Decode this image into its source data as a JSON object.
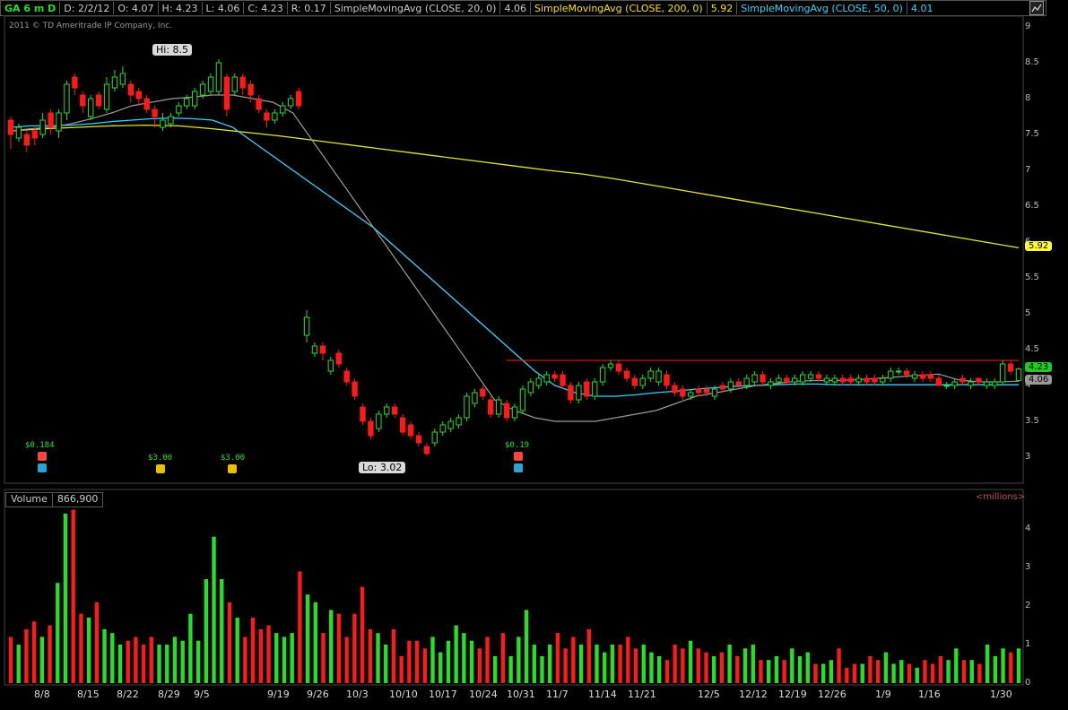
{
  "header": {
    "symbol": "GA 6 m D",
    "date": "D: 2/2/12",
    "open": "O: 4.07",
    "high": "H: 4.23",
    "low": "L: 4.06",
    "close": "C: 4.23",
    "range": "R: 0.17",
    "sma20_label": "SimpleMovingAvg (CLOSE, 20, 0)",
    "sma20_value": "4.06",
    "sma200_label": "SimpleMovingAvg (CLOSE, 200, 0)",
    "sma200_value": "5.92",
    "sma50_label": "SimpleMovingAvg (CLOSE, 50, 0)",
    "sma50_value": "4.01"
  },
  "copyright": "2011 © TD Ameritrade IP Company, Inc.",
  "volume_header": {
    "label": "Volume",
    "value": "866,900",
    "units": "<millions>"
  },
  "colors": {
    "up": "#25e025",
    "down": "#ff1a1a",
    "sma20": "#9a9a9a",
    "sma50": "#33d6ff",
    "sma200": "#e6e633",
    "resistance": "#ff2020"
  },
  "chart_data": [
    {
      "type": "candlestick",
      "title": "GA 6 m D",
      "ylim": [
        2.75,
        9.1
      ],
      "yticks": [
        "9",
        "8.5",
        "8",
        "7.5",
        "7",
        "6.5",
        "6",
        "5.5",
        "5",
        "4.5",
        "4",
        "3.5",
        "3"
      ],
      "xticks": [
        "8/8",
        "8/15",
        "8/22",
        "8/29",
        "9/5",
        "9/19",
        "9/26",
        "10/3",
        "10/10",
        "10/17",
        "10/24",
        "10/31",
        "11/7",
        "11/14",
        "11/21",
        "12/5",
        "12/12",
        "12/19",
        "12/26",
        "1/9",
        "1/16",
        "1/30"
      ],
      "close": [
        7.5,
        7.6,
        7.35,
        7.45,
        7.7,
        7.6,
        7.8,
        8.2,
        8.15,
        7.9,
        8.0,
        7.9,
        8.2,
        8.3,
        8.35,
        8.05,
        8.0,
        7.85,
        7.75,
        7.7,
        7.75,
        7.9,
        8.0,
        8.1,
        8.2,
        8.3,
        8.5,
        7.85,
        8.3,
        8.15,
        8.05,
        7.85,
        7.7,
        7.8,
        7.9,
        8.0,
        7.9,
        4.95,
        4.55,
        4.45,
        4.35,
        4.3,
        4.05,
        3.85,
        3.5,
        3.3,
        3.6,
        3.7,
        3.6,
        3.35,
        3.3,
        3.2,
        3.05,
        3.35,
        3.45,
        3.5,
        3.55,
        3.85,
        3.9,
        3.85,
        3.6,
        3.8,
        3.55,
        3.7,
        3.95,
        4.05,
        4.1,
        4.15,
        4.1,
        4.0,
        3.8,
        4.0,
        3.85,
        4.05,
        4.25,
        4.3,
        4.2,
        4.1,
        4.0,
        4.1,
        4.2,
        4.2,
        4.0,
        3.9,
        3.85,
        3.9,
        3.9,
        3.9,
        3.95,
        3.95,
        4.05,
        4.0,
        4.1,
        4.15,
        4.05,
        4.05,
        4.1,
        4.05,
        4.1,
        4.15,
        4.15,
        4.1,
        4.1,
        4.1,
        4.05,
        4.05,
        4.1,
        4.05,
        4.05,
        4.1,
        4.2,
        4.2,
        4.15,
        4.15,
        4.1,
        4.1,
        4.0,
        4.0,
        4.05,
        4.05,
        4.05,
        4.05,
        4.05,
        4.05,
        4.3,
        4.2,
        4.23
      ],
      "open": [
        7.7,
        7.45,
        7.5,
        7.55,
        7.5,
        7.8,
        7.55,
        7.8,
        8.3,
        8.05,
        7.75,
        8.05,
        7.85,
        8.15,
        8.2,
        8.2,
        8.1,
        8.0,
        7.85,
        7.6,
        7.65,
        7.8,
        7.9,
        7.9,
        8.05,
        8.1,
        8.1,
        8.3,
        8.1,
        8.3,
        8.2,
        8.0,
        7.8,
        7.7,
        7.8,
        7.9,
        8.1,
        4.7,
        4.45,
        4.55,
        4.2,
        4.45,
        4.2,
        4.05,
        3.7,
        3.5,
        3.4,
        3.6,
        3.7,
        3.55,
        3.45,
        3.3,
        3.15,
        3.2,
        3.35,
        3.4,
        3.45,
        3.55,
        3.75,
        3.95,
        3.8,
        3.6,
        3.75,
        3.55,
        3.65,
        3.9,
        4.0,
        4.05,
        4.15,
        4.15,
        4.0,
        3.8,
        4.05,
        3.85,
        4.05,
        4.25,
        4.3,
        4.2,
        4.1,
        4.0,
        4.1,
        4.05,
        4.15,
        4.0,
        3.95,
        3.85,
        3.95,
        3.95,
        3.85,
        4.0,
        3.95,
        4.05,
        4.0,
        4.05,
        4.15,
        4.0,
        4.05,
        4.1,
        4.05,
        4.05,
        4.1,
        4.15,
        4.05,
        4.05,
        4.1,
        4.1,
        4.05,
        4.1,
        4.1,
        4.05,
        4.1,
        4.2,
        4.2,
        4.1,
        4.15,
        4.15,
        4.1,
        4.0,
        4.0,
        4.1,
        4.0,
        4.1,
        4.0,
        4.0,
        4.05,
        4.3,
        4.07
      ],
      "high": [
        7.75,
        7.65,
        7.55,
        7.6,
        7.8,
        7.85,
        7.85,
        8.25,
        8.35,
        8.1,
        8.05,
        8.1,
        8.3,
        8.4,
        8.45,
        8.25,
        8.15,
        8.05,
        7.9,
        7.8,
        7.8,
        7.95,
        8.05,
        8.15,
        8.25,
        8.35,
        8.55,
        8.35,
        8.35,
        8.35,
        8.25,
        8.05,
        7.85,
        7.85,
        7.95,
        8.05,
        8.15,
        5.05,
        4.6,
        4.6,
        4.4,
        4.5,
        4.25,
        4.1,
        3.75,
        3.55,
        3.65,
        3.75,
        3.75,
        3.6,
        3.5,
        3.35,
        3.2,
        3.4,
        3.5,
        3.55,
        3.6,
        3.9,
        3.95,
        4.0,
        3.85,
        3.85,
        3.8,
        3.75,
        4.0,
        4.1,
        4.15,
        4.2,
        4.2,
        4.2,
        4.05,
        4.05,
        4.1,
        4.1,
        4.3,
        4.35,
        4.35,
        4.25,
        4.15,
        4.15,
        4.25,
        4.25,
        4.2,
        4.05,
        4.0,
        3.95,
        4.0,
        4.0,
        4.0,
        4.05,
        4.1,
        4.1,
        4.15,
        4.2,
        4.2,
        4.1,
        4.15,
        4.15,
        4.15,
        4.2,
        4.2,
        4.2,
        4.15,
        4.15,
        4.15,
        4.15,
        4.15,
        4.15,
        4.15,
        4.15,
        4.25,
        4.25,
        4.25,
        4.2,
        4.2,
        4.2,
        4.15,
        4.05,
        4.1,
        4.15,
        4.1,
        4.1,
        4.1,
        4.1,
        4.35,
        4.35,
        4.25
      ],
      "low": [
        7.3,
        7.4,
        7.25,
        7.35,
        7.45,
        7.5,
        7.45,
        7.7,
        8.05,
        7.8,
        7.7,
        7.85,
        7.8,
        8.1,
        8.15,
        7.95,
        7.9,
        7.8,
        7.6,
        7.55,
        7.6,
        7.75,
        7.85,
        7.85,
        8.0,
        8.05,
        8.05,
        7.75,
        8.05,
        8.05,
        7.95,
        7.8,
        7.6,
        7.65,
        7.75,
        7.85,
        7.85,
        4.6,
        4.4,
        4.35,
        4.15,
        4.25,
        4.0,
        3.8,
        3.45,
        3.25,
        3.35,
        3.55,
        3.55,
        3.3,
        3.25,
        3.15,
        3.02,
        3.15,
        3.3,
        3.35,
        3.4,
        3.5,
        3.7,
        3.8,
        3.55,
        3.55,
        3.5,
        3.5,
        3.6,
        3.85,
        3.95,
        4.0,
        4.05,
        3.95,
        3.75,
        3.75,
        3.8,
        3.8,
        4.0,
        4.2,
        4.15,
        4.05,
        3.95,
        3.95,
        4.05,
        4.0,
        3.95,
        3.85,
        3.8,
        3.8,
        3.85,
        3.85,
        3.8,
        3.9,
        3.9,
        3.95,
        3.95,
        4.0,
        4.0,
        3.95,
        4.0,
        4.0,
        4.0,
        4.0,
        4.05,
        4.05,
        4.0,
        4.0,
        4.0,
        4.0,
        4.0,
        4.0,
        4.0,
        4.0,
        4.05,
        4.15,
        4.1,
        4.05,
        4.05,
        4.05,
        4.0,
        3.95,
        3.95,
        4.0,
        3.95,
        4.0,
        3.95,
        3.95,
        4.0,
        4.15,
        4.05
      ],
      "sma20": [
        7.55,
        7.58,
        7.6,
        7.65,
        7.72,
        7.8,
        7.9,
        7.95,
        8.0,
        8.02,
        8.05,
        8.05,
        8.0,
        7.95,
        7.8,
        7.4,
        7.0,
        6.6,
        6.2,
        5.8,
        5.4,
        5.0,
        4.6,
        4.2,
        3.8,
        3.65,
        3.55,
        3.5,
        3.5,
        3.5,
        3.55,
        3.6,
        3.65,
        3.75,
        3.85,
        3.9,
        3.95,
        4.0,
        4.03,
        4.06,
        4.07,
        4.07,
        4.08,
        4.1,
        4.12,
        4.14,
        4.16,
        4.08,
        4.05,
        4.05,
        4.06
      ],
      "sma50": [
        7.6,
        7.62,
        7.62,
        7.63,
        7.65,
        7.68,
        7.7,
        7.72,
        7.73,
        7.72,
        7.7,
        7.6,
        7.4,
        7.2,
        7.0,
        6.8,
        6.6,
        6.4,
        6.2,
        5.95,
        5.7,
        5.45,
        5.2,
        4.95,
        4.7,
        4.45,
        4.2,
        4.0,
        3.9,
        3.85,
        3.85,
        3.87,
        3.9,
        3.92,
        3.95,
        3.97,
        3.99,
        4.0,
        4.01,
        4.02,
        4.02,
        4.01,
        4.01,
        4.01,
        4.01,
        4.01,
        4.01,
        4.01,
        4.01,
        4.01,
        4.01
      ],
      "sma200": [
        7.55,
        7.58,
        7.6,
        7.62,
        7.63,
        7.62,
        7.58,
        7.53,
        7.48,
        7.42,
        7.36,
        7.3,
        7.24,
        7.18,
        7.12,
        7.06,
        7.0,
        6.95,
        6.88,
        6.8,
        6.72,
        6.64,
        6.56,
        6.48,
        6.4,
        6.32,
        6.24,
        6.16,
        6.08,
        6.0,
        5.92
      ],
      "resistance": 4.35,
      "annotations": {
        "hi": "Hi: 8.5",
        "lo": "Lo: 3.02",
        "last": "4.23",
        "sma20_last": "4.06",
        "sma200_last": "5.92"
      },
      "dividends": [
        "$0.184",
        "$3.00",
        "$3.00",
        "$0.19"
      ]
    },
    {
      "type": "bar",
      "title": "Volume",
      "ylim": [
        0,
        4.7
      ],
      "yticks": [
        "4",
        "3",
        "2",
        "1",
        "0"
      ],
      "values": [
        1.2,
        1.0,
        1.4,
        1.6,
        1.2,
        1.5,
        2.6,
        4.4,
        4.5,
        1.8,
        1.7,
        2.1,
        1.4,
        1.3,
        1.0,
        1.1,
        1.2,
        1.0,
        1.2,
        1.0,
        1.0,
        1.2,
        1.1,
        1.8,
        1.1,
        2.7,
        3.8,
        2.7,
        2.1,
        1.7,
        1.2,
        1.7,
        1.4,
        1.5,
        1.3,
        1.2,
        1.3,
        2.9,
        2.3,
        2.1,
        1.3,
        1.9,
        1.8,
        1.2,
        1.8,
        2.5,
        1.4,
        1.3,
        1.0,
        1.4,
        0.7,
        1.1,
        1.1,
        0.9,
        1.2,
        0.8,
        1.1,
        1.5,
        1.3,
        1.1,
        0.9,
        1.2,
        0.7,
        1.3,
        0.7,
        1.2,
        1.9,
        1.0,
        0.7,
        1.0,
        1.3,
        0.9,
        1.2,
        1.0,
        1.4,
        1.0,
        0.8,
        1.0,
        1.0,
        1.2,
        0.9,
        1.0,
        0.8,
        0.7,
        0.6,
        1.0,
        0.9,
        1.1,
        0.9,
        0.8,
        0.7,
        0.8,
        1.0,
        0.7,
        0.9,
        1.0,
        0.6,
        0.6,
        0.7,
        0.6,
        0.9,
        0.7,
        0.8,
        0.5,
        0.5,
        0.6,
        0.9,
        0.4,
        0.5,
        0.5,
        0.7,
        0.6,
        0.8,
        0.5,
        0.6,
        0.5,
        0.4,
        0.6,
        0.5,
        0.7,
        0.6,
        0.9,
        0.6,
        0.6,
        0.5,
        1.0,
        0.7,
        0.9,
        0.8,
        0.9
      ]
    }
  ]
}
